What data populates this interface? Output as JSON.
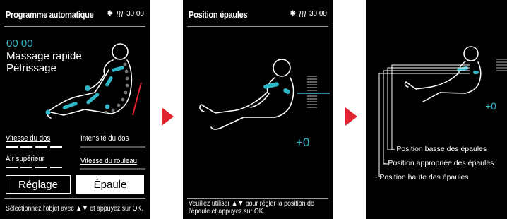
{
  "screen1": {
    "title": "Programme automatique",
    "status_time": "30 00",
    "timer": "00 00",
    "program_line1": "Massage rapide",
    "program_line2": "Pétrissage",
    "label_back_speed": "Vitesse du dos",
    "label_back_intensity": "Intensité du dos",
    "label_air_upper": "Air supérieur",
    "label_roller_speed": "Vitesse du rouleau",
    "button_setting": "Réglage",
    "button_shoulder": "Épaule",
    "footer": "Sélectionnez l'objet avec ▲▼ et appuyez sur OK."
  },
  "screen2": {
    "title": "Position épaules",
    "status_time": "30 00",
    "offset": "+0",
    "footer_line1": "Veuillez utiliser ▲▼ pour régler la position de",
    "footer_line2": "l'épaule et appuyez sur OK."
  },
  "screen3": {
    "offset": "+0",
    "ann_low": "· Position basse des épaules",
    "ann_mid": "· Position appropriée des épaules",
    "ann_high": "· Position haute des épaules"
  },
  "colors": {
    "accent": "#31b8c8",
    "arrow": "#e0242f",
    "screen_bg": "#000000"
  },
  "icons": {
    "bluetooth": "bluetooth-icon",
    "heat": "heat-icon",
    "flow_arrow": "red-arrow-icon"
  }
}
